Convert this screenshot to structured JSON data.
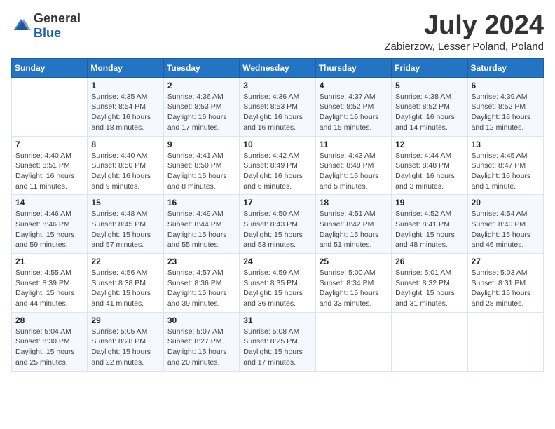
{
  "header": {
    "logo_general": "General",
    "logo_blue": "Blue",
    "title": "July 2024",
    "subtitle": "Zabierzow, Lesser Poland, Poland"
  },
  "days_of_week": [
    "Sunday",
    "Monday",
    "Tuesday",
    "Wednesday",
    "Thursday",
    "Friday",
    "Saturday"
  ],
  "weeks": [
    [
      {
        "day": "",
        "info": ""
      },
      {
        "day": "1",
        "info": "Sunrise: 4:35 AM\nSunset: 8:54 PM\nDaylight: 16 hours and 18 minutes."
      },
      {
        "day": "2",
        "info": "Sunrise: 4:36 AM\nSunset: 8:53 PM\nDaylight: 16 hours and 17 minutes."
      },
      {
        "day": "3",
        "info": "Sunrise: 4:36 AM\nSunset: 8:53 PM\nDaylight: 16 hours and 16 minutes."
      },
      {
        "day": "4",
        "info": "Sunrise: 4:37 AM\nSunset: 8:52 PM\nDaylight: 16 hours and 15 minutes."
      },
      {
        "day": "5",
        "info": "Sunrise: 4:38 AM\nSunset: 8:52 PM\nDaylight: 16 hours and 14 minutes."
      },
      {
        "day": "6",
        "info": "Sunrise: 4:39 AM\nSunset: 8:52 PM\nDaylight: 16 hours and 12 minutes."
      }
    ],
    [
      {
        "day": "7",
        "info": "Sunrise: 4:40 AM\nSunset: 8:51 PM\nDaylight: 16 hours and 11 minutes."
      },
      {
        "day": "8",
        "info": "Sunrise: 4:40 AM\nSunset: 8:50 PM\nDaylight: 16 hours and 9 minutes."
      },
      {
        "day": "9",
        "info": "Sunrise: 4:41 AM\nSunset: 8:50 PM\nDaylight: 16 hours and 8 minutes."
      },
      {
        "day": "10",
        "info": "Sunrise: 4:42 AM\nSunset: 8:49 PM\nDaylight: 16 hours and 6 minutes."
      },
      {
        "day": "11",
        "info": "Sunrise: 4:43 AM\nSunset: 8:48 PM\nDaylight: 16 hours and 5 minutes."
      },
      {
        "day": "12",
        "info": "Sunrise: 4:44 AM\nSunset: 8:48 PM\nDaylight: 16 hours and 3 minutes."
      },
      {
        "day": "13",
        "info": "Sunrise: 4:45 AM\nSunset: 8:47 PM\nDaylight: 16 hours and 1 minute."
      }
    ],
    [
      {
        "day": "14",
        "info": "Sunrise: 4:46 AM\nSunset: 8:46 PM\nDaylight: 15 hours and 59 minutes."
      },
      {
        "day": "15",
        "info": "Sunrise: 4:48 AM\nSunset: 8:45 PM\nDaylight: 15 hours and 57 minutes."
      },
      {
        "day": "16",
        "info": "Sunrise: 4:49 AM\nSunset: 8:44 PM\nDaylight: 15 hours and 55 minutes."
      },
      {
        "day": "17",
        "info": "Sunrise: 4:50 AM\nSunset: 8:43 PM\nDaylight: 15 hours and 53 minutes."
      },
      {
        "day": "18",
        "info": "Sunrise: 4:51 AM\nSunset: 8:42 PM\nDaylight: 15 hours and 51 minutes."
      },
      {
        "day": "19",
        "info": "Sunrise: 4:52 AM\nSunset: 8:41 PM\nDaylight: 15 hours and 48 minutes."
      },
      {
        "day": "20",
        "info": "Sunrise: 4:54 AM\nSunset: 8:40 PM\nDaylight: 15 hours and 46 minutes."
      }
    ],
    [
      {
        "day": "21",
        "info": "Sunrise: 4:55 AM\nSunset: 8:39 PM\nDaylight: 15 hours and 44 minutes."
      },
      {
        "day": "22",
        "info": "Sunrise: 4:56 AM\nSunset: 8:38 PM\nDaylight: 15 hours and 41 minutes."
      },
      {
        "day": "23",
        "info": "Sunrise: 4:57 AM\nSunset: 8:36 PM\nDaylight: 15 hours and 39 minutes."
      },
      {
        "day": "24",
        "info": "Sunrise: 4:59 AM\nSunset: 8:35 PM\nDaylight: 15 hours and 36 minutes."
      },
      {
        "day": "25",
        "info": "Sunrise: 5:00 AM\nSunset: 8:34 PM\nDaylight: 15 hours and 33 minutes."
      },
      {
        "day": "26",
        "info": "Sunrise: 5:01 AM\nSunset: 8:32 PM\nDaylight: 15 hours and 31 minutes."
      },
      {
        "day": "27",
        "info": "Sunrise: 5:03 AM\nSunset: 8:31 PM\nDaylight: 15 hours and 28 minutes."
      }
    ],
    [
      {
        "day": "28",
        "info": "Sunrise: 5:04 AM\nSunset: 8:30 PM\nDaylight: 15 hours and 25 minutes."
      },
      {
        "day": "29",
        "info": "Sunrise: 5:05 AM\nSunset: 8:28 PM\nDaylight: 15 hours and 22 minutes."
      },
      {
        "day": "30",
        "info": "Sunrise: 5:07 AM\nSunset: 8:27 PM\nDaylight: 15 hours and 20 minutes."
      },
      {
        "day": "31",
        "info": "Sunrise: 5:08 AM\nSunset: 8:25 PM\nDaylight: 15 hours and 17 minutes."
      },
      {
        "day": "",
        "info": ""
      },
      {
        "day": "",
        "info": ""
      },
      {
        "day": "",
        "info": ""
      }
    ]
  ]
}
